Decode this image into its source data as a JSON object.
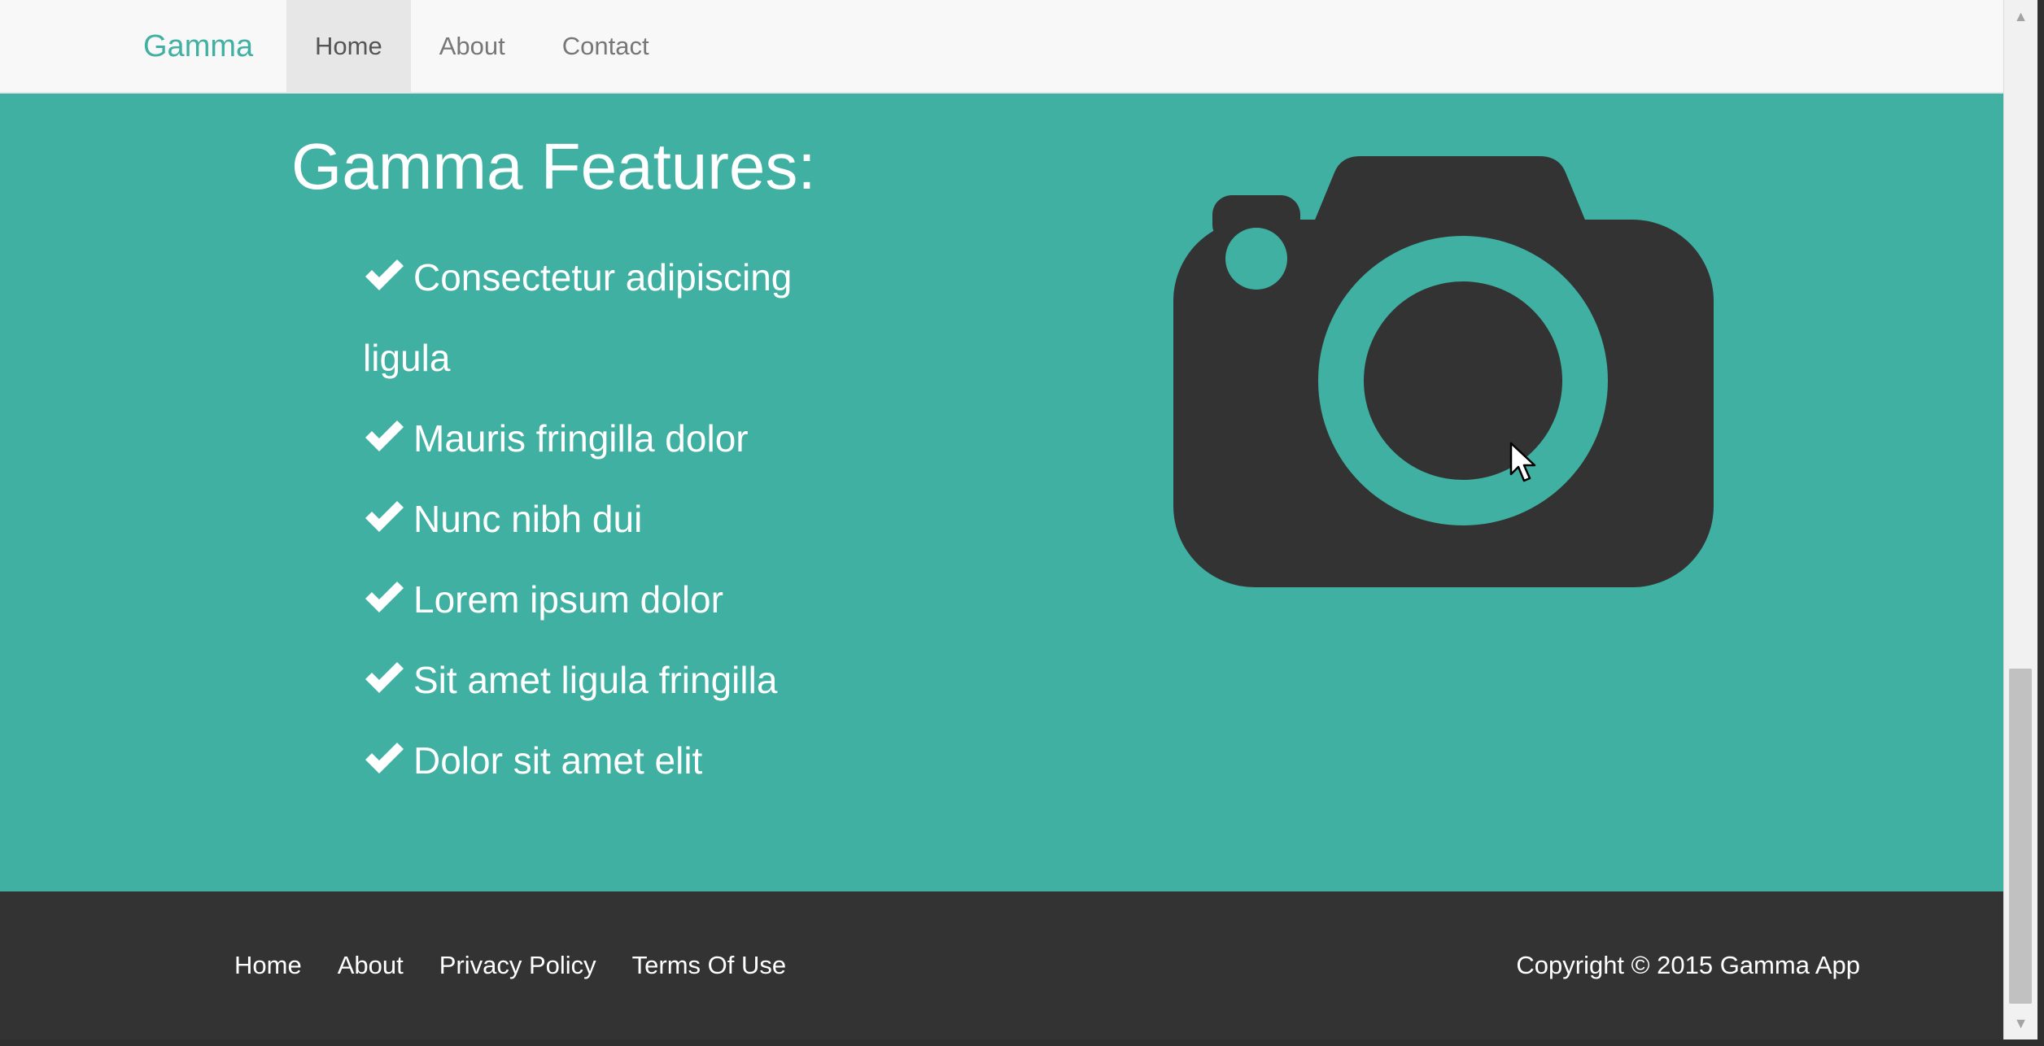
{
  "navbar": {
    "brand": "Gamma",
    "links": [
      {
        "label": "Home",
        "active": true
      },
      {
        "label": "About",
        "active": false
      },
      {
        "label": "Contact",
        "active": false
      }
    ]
  },
  "features": {
    "title": "Gamma Features:",
    "items": [
      "Consectetur adipiscing ligula",
      "Mauris fringilla dolor",
      "Nunc nibh dui",
      "Lorem ipsum dolor",
      "Sit amet ligula fringilla",
      "Dolor sit amet elit"
    ],
    "icon": "check-icon"
  },
  "hero_image": {
    "icon": "camera-icon"
  },
  "footer": {
    "links": [
      "Home",
      "About",
      "Privacy Policy",
      "Terms Of Use"
    ],
    "copyright": "Copyright © 2015 Gamma App"
  },
  "colors": {
    "accent": "#3fb0a1",
    "navbar_bg": "#f8f8f8",
    "footer_bg": "#333333",
    "camera": "#333333"
  }
}
